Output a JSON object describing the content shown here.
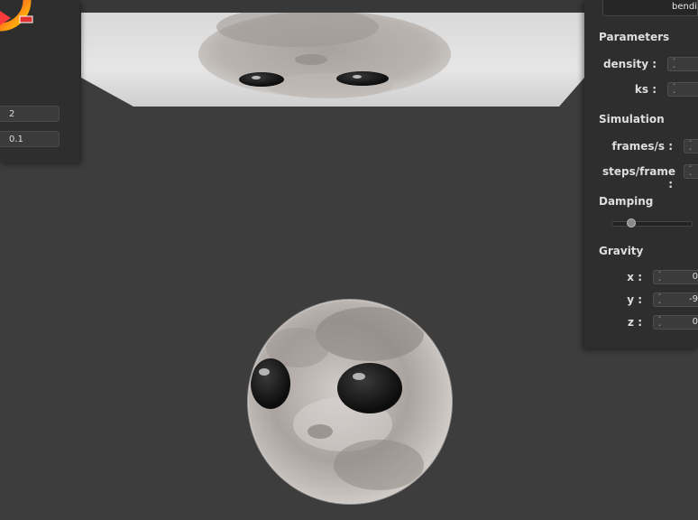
{
  "left_panel": {
    "fields": [
      "2",
      "0.1"
    ]
  },
  "right_panel": {
    "mode_button": "bendi",
    "parameters": {
      "title": "Parameters",
      "density_label": "density :",
      "ks_label": "ks :"
    },
    "simulation": {
      "title": "Simulation",
      "fps_label": "frames/s :",
      "steps_label": "steps/frame :"
    },
    "damping": {
      "title": "Damping",
      "value": 0.2
    },
    "gravity": {
      "title": "Gravity",
      "x_label": "x :",
      "y_label": "y :",
      "z_label": "z :",
      "x_value": "0",
      "y_value": "-9",
      "z_value": "0"
    }
  },
  "colors": {
    "background": "#3d3d3d",
    "panel": "#2e2e2e",
    "wheel_marker": "#e03030"
  }
}
